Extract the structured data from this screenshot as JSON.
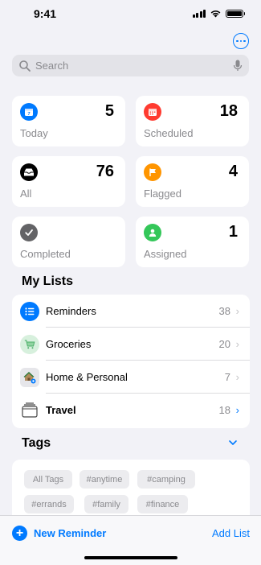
{
  "status_bar": {
    "time": "9:41"
  },
  "search": {
    "placeholder": "Search"
  },
  "smart_lists": [
    {
      "label": "Today",
      "count": "5",
      "color": "#007aff",
      "icon": "calendar-icon"
    },
    {
      "label": "Scheduled",
      "count": "18",
      "color": "#ff3b30",
      "icon": "calendar-grid-icon"
    },
    {
      "label": "All",
      "count": "76",
      "color": "#000000",
      "icon": "tray-icon"
    },
    {
      "label": "Flagged",
      "count": "4",
      "color": "#ff9500",
      "icon": "flag-icon"
    },
    {
      "label": "Completed",
      "count": "",
      "color": "#636366",
      "icon": "checkmark-icon"
    },
    {
      "label": "Assigned",
      "count": "1",
      "color": "#34c759",
      "icon": "person-icon"
    }
  ],
  "my_lists": {
    "title": "My Lists",
    "items": [
      {
        "name": "Reminders",
        "count": "38",
        "icon": "list-icon",
        "color": "#007aff"
      },
      {
        "name": "Groceries",
        "count": "20",
        "icon": "cart-icon",
        "color": "#34c759"
      },
      {
        "name": "Home & Personal",
        "count": "7",
        "icon": "house-icon",
        "color": "#8e8e93"
      },
      {
        "name": "Travel",
        "count": "18",
        "icon": "suitcase-icon",
        "color": "#000000"
      }
    ]
  },
  "tags": {
    "title": "Tags",
    "items": [
      "All Tags",
      "#anytime",
      "#camping",
      "#errands",
      "#family",
      "#finance"
    ]
  },
  "toolbar": {
    "new_reminder": "New Reminder",
    "add_list": "Add List"
  },
  "colors": {
    "accent": "#007aff"
  }
}
